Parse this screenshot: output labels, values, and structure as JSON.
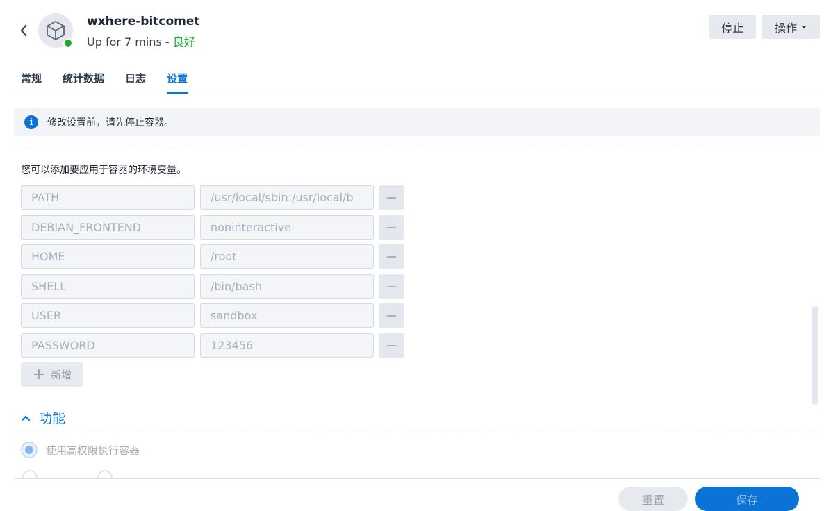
{
  "header": {
    "app_name": "wxhere-bitcomet",
    "status_prefix": "Up for 7 mins - ",
    "status_health": "良好",
    "status_color": "#1aab29",
    "stop_label": "停止",
    "action_label": "操作",
    "back_icon": "chevron-left-icon",
    "app_icon": "cube-icon"
  },
  "tabs": [
    {
      "label": "常规",
      "active": false
    },
    {
      "label": "统计数据",
      "active": false
    },
    {
      "label": "日志",
      "active": false
    },
    {
      "label": "设置",
      "active": true
    }
  ],
  "notice": {
    "text": "修改设置前，请先停止容器。",
    "icon": "info-icon"
  },
  "env": {
    "description": "您可以添加要应用于容器的环境变量。",
    "variables": [
      {
        "key": "PATH",
        "value": "/usr/local/sbin:/usr/local/b"
      },
      {
        "key": "DEBIAN_FRONTEND",
        "value": "noninteractive"
      },
      {
        "key": "HOME",
        "value": "/root"
      },
      {
        "key": "SHELL",
        "value": "/bin/bash"
      },
      {
        "key": "USER",
        "value": "sandbox"
      },
      {
        "key": "PASSWORD",
        "value": "123456"
      }
    ],
    "add_label": "新增"
  },
  "features": {
    "title": "功能",
    "privileged_label": "使用高权限执行容器",
    "privileged_checked": true
  },
  "footer": {
    "reset_label": "重置",
    "save_label": "保存"
  },
  "colors": {
    "accent": "#0b72d6"
  }
}
